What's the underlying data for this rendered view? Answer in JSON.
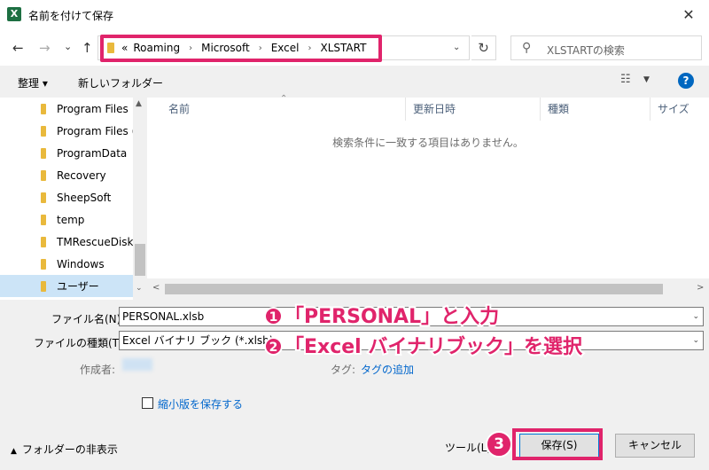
{
  "window": {
    "title": "名前を付けて保存",
    "app_icon": "X",
    "close_glyph": "✕"
  },
  "nav": {
    "back_glyph": "←",
    "forward_glyph": "→",
    "recent_glyph": "⌄",
    "up_glyph": "↑",
    "breadcrumb": {
      "overflow": "«",
      "items": [
        "Roaming",
        "Microsoft",
        "Excel",
        "XLSTART"
      ],
      "separator": "›"
    },
    "dropdown_glyph": "⌄",
    "refresh_glyph": "↻",
    "search_placeholder": "XLSTARTの検索",
    "search_glyph": "⚲"
  },
  "toolbar": {
    "organize_label": "整理 ▾",
    "new_folder_label": "新しいフォルダー",
    "view_glyph": "☷",
    "view_chevron": "▼",
    "help_glyph": "?"
  },
  "sidebar": {
    "items": [
      {
        "label": "Program Files"
      },
      {
        "label": "Program Files ("
      },
      {
        "label": "ProgramData"
      },
      {
        "label": "Recovery"
      },
      {
        "label": "SheepSoft"
      },
      {
        "label": "temp"
      },
      {
        "label": "TMRescueDisk"
      },
      {
        "label": "Windows"
      },
      {
        "label": "ユーザー",
        "selected": true
      }
    ],
    "scroll_up_glyph": "▲",
    "scroll_down_glyph": "⌄"
  },
  "file_list": {
    "columns": [
      "名前",
      "更新日時",
      "種類",
      "サイズ"
    ],
    "sort_glyph": "⌃",
    "empty_message": "検索条件に一致する項目はありません。",
    "scroll_left_glyph": "<",
    "scroll_right_glyph": ">"
  },
  "form": {
    "filename_label": "ファイル名(N):",
    "filename_value": "PERSONAL.xlsb",
    "filetype_label": "ファイルの種類(T):",
    "filetype_value": "Excel バイナリ ブック (*.xlsb)",
    "author_label": "作成者:",
    "tags_label": "タグ:",
    "tags_value": "タグの追加",
    "thumbnail_label": "縮小版を保存する",
    "chevron_glyph": "⌄"
  },
  "footer": {
    "hide_folders_label": "フォルダーの非表示",
    "hide_folders_glyph": "▲",
    "tools_label": "ツール(L)",
    "save_label": "保存(S)",
    "cancel_label": "キャンセル"
  },
  "annotations": {
    "step1_num": "1",
    "step1_text": "「PERSONAL」と入力",
    "step2_num": "2",
    "step2_text": "「Excel バイナリブック」を選択",
    "step3_num": "3",
    "color": "#e0246b"
  }
}
